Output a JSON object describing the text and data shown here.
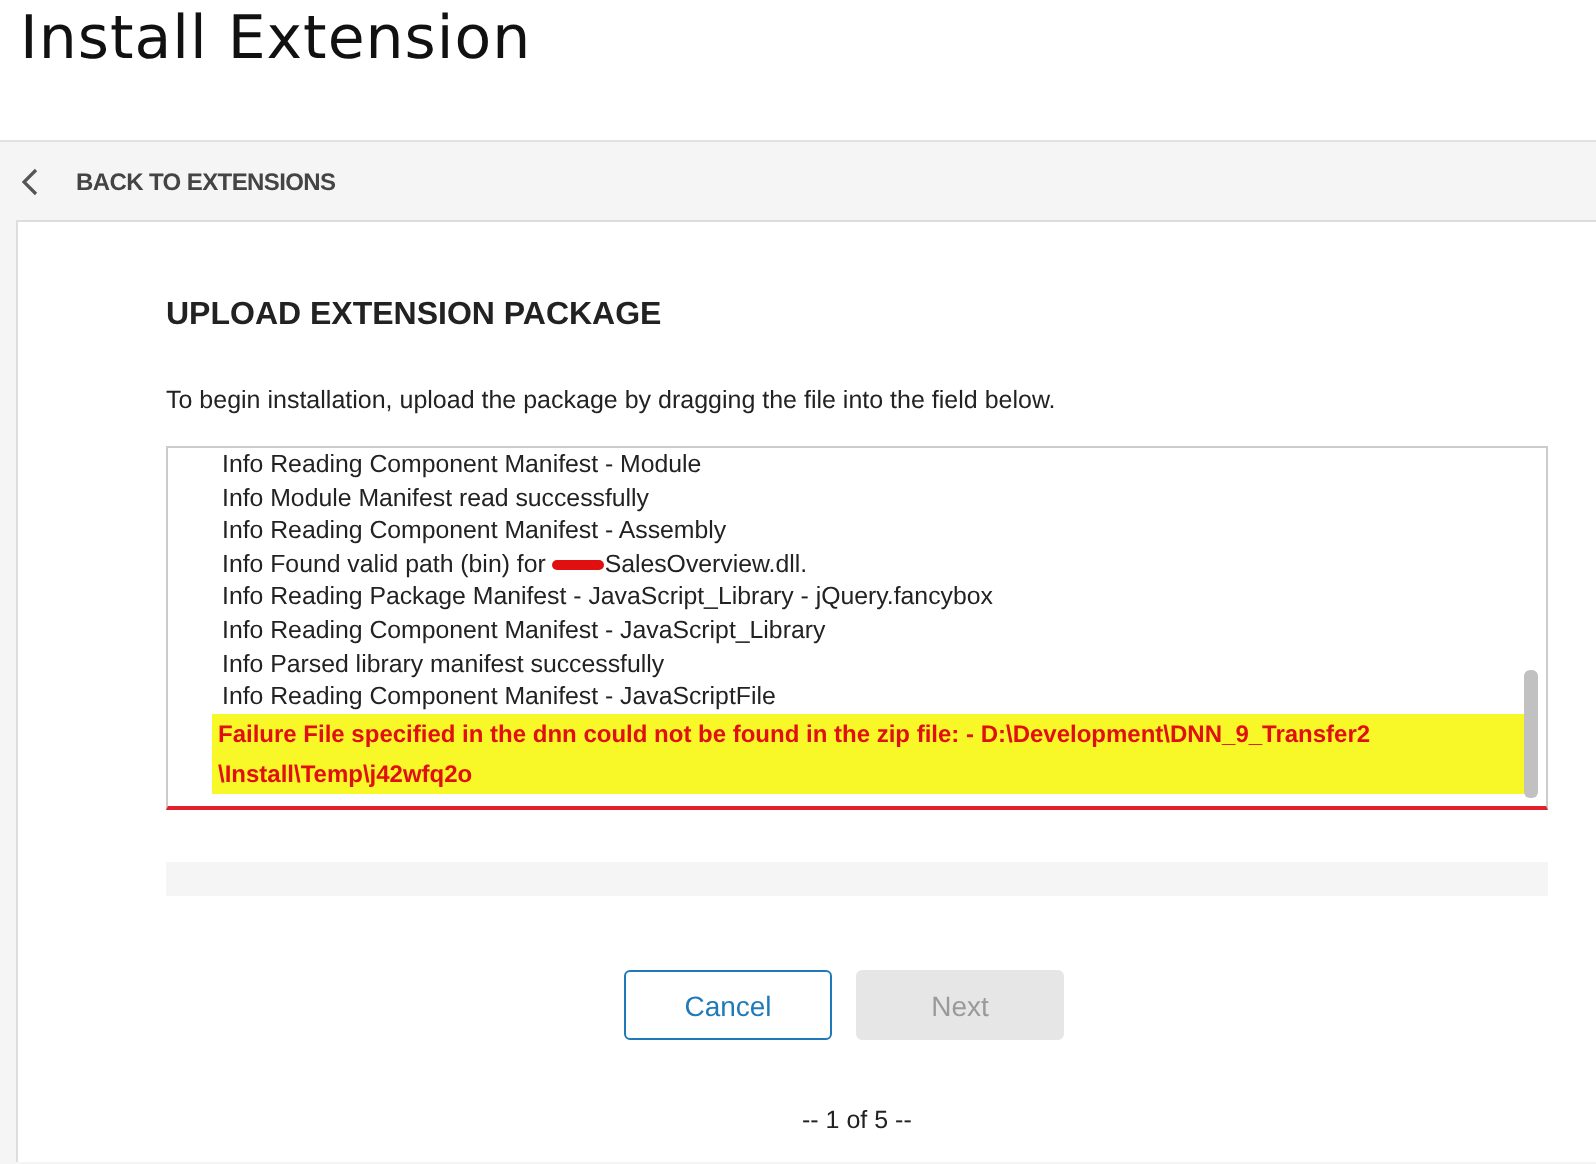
{
  "page_title": "Install Extension",
  "back_link": {
    "label": "BACK TO EXTENSIONS"
  },
  "heading": "UPLOAD EXTENSION PACKAGE",
  "instructions": "To begin installation, upload the package by dragging the file into the field below.",
  "log": [
    {
      "kind": "info",
      "text": "Info Reading Component Manifest - Module"
    },
    {
      "kind": "info",
      "text": "Info Module Manifest read successfully"
    },
    {
      "kind": "info",
      "text": "Info Reading Component Manifest - Assembly"
    },
    {
      "kind": "redacted",
      "before": "Info Found valid path (bin) for ",
      "after": "SalesOverview.dll."
    },
    {
      "kind": "info",
      "text": "Info Reading Package Manifest - JavaScript_Library - jQuery.fancybox"
    },
    {
      "kind": "info",
      "text": "Info Reading Component Manifest - JavaScript_Library"
    },
    {
      "kind": "info",
      "text": "Info Parsed library manifest successfully"
    },
    {
      "kind": "info",
      "text": "Info Reading Component Manifest - JavaScriptFile"
    },
    {
      "kind": "failure",
      "text": "Failure File specified in the dnn could not be found in the zip file: - D:\\Development\\DNN_9_Transfer2 \\Install\\Temp\\j42wfq2o"
    }
  ],
  "buttons": [
    {
      "label": "Cancel",
      "disabled": false
    },
    {
      "label": "Next",
      "disabled": true
    }
  ],
  "pager": "-- 1 of 5 --"
}
